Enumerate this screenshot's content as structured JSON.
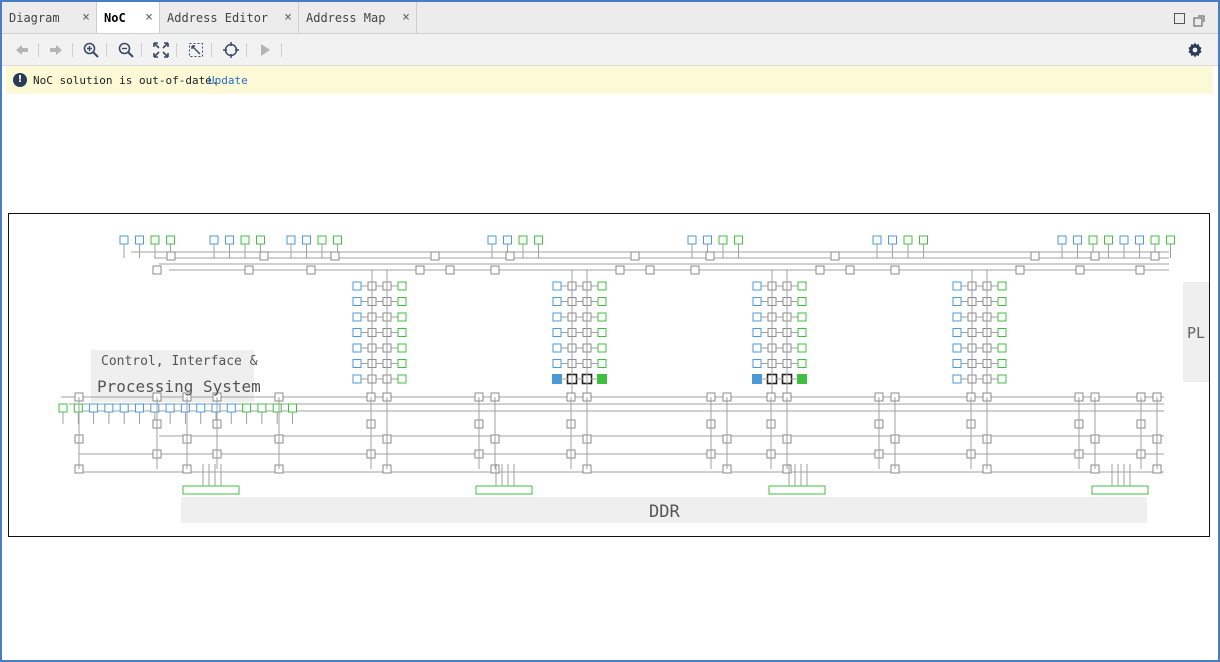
{
  "tabs": [
    {
      "label": "Diagram",
      "active": false
    },
    {
      "label": "NoC",
      "active": true
    },
    {
      "label": "Address Editor",
      "active": false
    },
    {
      "label": "Address Map",
      "active": false
    }
  ],
  "tab_close_glyph": "×",
  "window_controls": [
    "maximize-icon",
    "restore-icon"
  ],
  "toolbar": {
    "buttons": [
      "back-arrow-icon",
      "forward-arrow-icon",
      "zoom-in-icon",
      "zoom-out-icon",
      "zoom-fit-icon",
      "fit-selection-icon",
      "auto-fit-target-icon",
      "run-icon"
    ],
    "settings": "gear-icon"
  },
  "banner": {
    "icon": "!",
    "message": "NoC solution is out-of-date.",
    "link": "Update"
  },
  "diagram": {
    "cips_label_line1": "Control, Interface &",
    "cips_label_line2": "Processing System",
    "ddr_label": "DDR",
    "pl_label": "PL"
  },
  "colors": {
    "frame_border": "#4a7ec4",
    "master_port": "#4a9ad8",
    "slave_port": "#3fbf3f",
    "node": "#8a8a8a",
    "wire": "#a0a0a0",
    "banner_bg": "#fbf9d6",
    "link": "#2a6cc5"
  }
}
